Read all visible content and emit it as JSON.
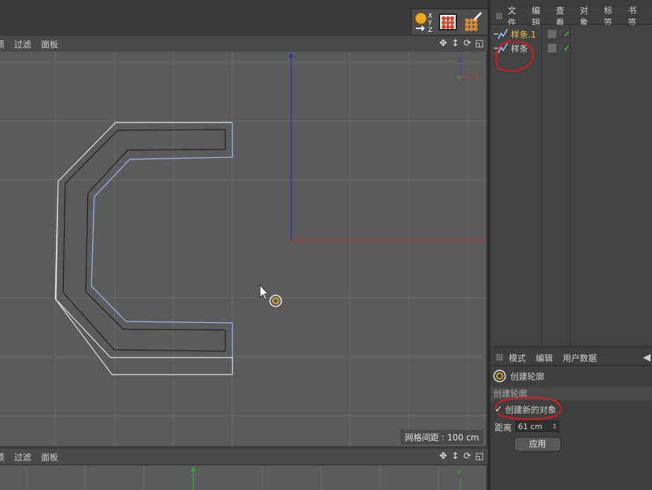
{
  "viewport_top": {
    "menu": [
      "顶",
      "过滤",
      "面板"
    ],
    "grid_spacing": "网格间距 : 100 cm",
    "axis_labels": {
      "z": "Z",
      "y": "Y",
      "x": "X"
    }
  },
  "viewport_bottom": {
    "menu": [
      "顶",
      "过滤",
      "面板"
    ],
    "axis_label_y": "Y"
  },
  "object_manager": {
    "menu": [
      "文件",
      "编辑",
      "查看",
      "对象",
      "标签",
      "书签"
    ],
    "objects": [
      {
        "name": "样条.1",
        "color": "#f0c040"
      },
      {
        "name": "样条",
        "color": "#d0d0d0"
      }
    ]
  },
  "attributes": {
    "menu": [
      "模式",
      "编辑",
      "用户数据"
    ],
    "tool_name": "创建轮廓",
    "section": "创建轮廓",
    "create_new_object_label": "创建新的对象",
    "create_new_object_checked": true,
    "distance_label": "距离",
    "distance_value": "61 cm",
    "apply_label": "应用"
  },
  "colors": {
    "accent_red_annotation": "#e01818",
    "selected_spline": "#9eb8ff",
    "axis_blue": "#2222cc",
    "axis_red": "#cc2222",
    "axis_green": "#22aa22"
  }
}
